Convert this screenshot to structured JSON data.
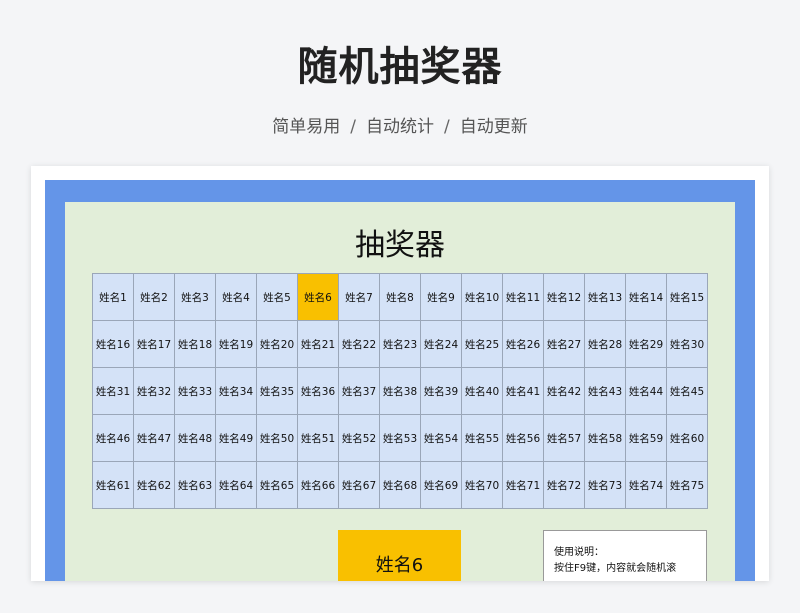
{
  "header": {
    "title": "随机抽奖器",
    "features": [
      "简单易用",
      "自动统计",
      "自动更新"
    ],
    "separator": "/"
  },
  "sheet": {
    "title": "抽奖器",
    "highlighted_index": 5,
    "names": [
      "姓名1",
      "姓名2",
      "姓名3",
      "姓名4",
      "姓名5",
      "姓名6",
      "姓名7",
      "姓名8",
      "姓名9",
      "姓名10",
      "姓名11",
      "姓名12",
      "姓名13",
      "姓名14",
      "姓名15",
      "姓名16",
      "姓名17",
      "姓名18",
      "姓名19",
      "姓名20",
      "姓名21",
      "姓名22",
      "姓名23",
      "姓名24",
      "姓名25",
      "姓名26",
      "姓名27",
      "姓名28",
      "姓名29",
      "姓名30",
      "姓名31",
      "姓名32",
      "姓名33",
      "姓名34",
      "姓名35",
      "姓名36",
      "姓名37",
      "姓名38",
      "姓名39",
      "姓名40",
      "姓名41",
      "姓名42",
      "姓名43",
      "姓名44",
      "姓名45",
      "姓名46",
      "姓名47",
      "姓名48",
      "姓名49",
      "姓名50",
      "姓名51",
      "姓名52",
      "姓名53",
      "姓名54",
      "姓名55",
      "姓名56",
      "姓名57",
      "姓名58",
      "姓名59",
      "姓名60",
      "姓名61",
      "姓名62",
      "姓名63",
      "姓名64",
      "姓名65",
      "姓名66",
      "姓名67",
      "姓名68",
      "姓名69",
      "姓名70",
      "姓名71",
      "姓名72",
      "姓名73",
      "姓名74",
      "姓名75"
    ],
    "result": "姓名6",
    "instructions": {
      "heading": "使用说明：",
      "line1": "按住F9键，内容就会随机滚"
    }
  },
  "colors": {
    "frame": "#6495e8",
    "sheet_bg": "#e2eed9",
    "cell_bg": "#d4e2f7",
    "highlight": "#f9c000"
  }
}
